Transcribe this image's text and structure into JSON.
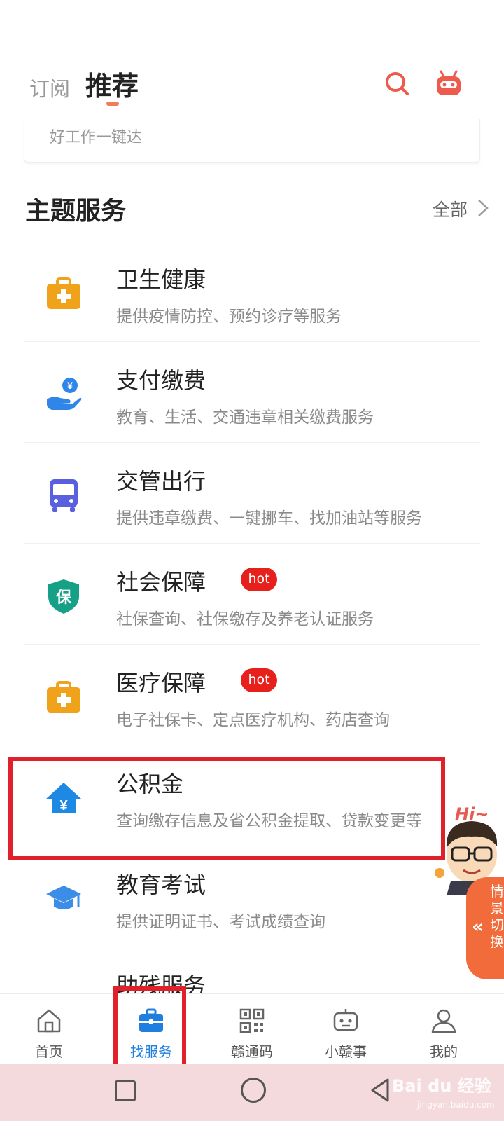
{
  "header": {
    "tab_subscribe": "订阅",
    "tab_recommend": "推荐",
    "search_icon": "search-icon",
    "robot_icon": "robot-icon"
  },
  "search": {
    "placeholder": "好工作一键达"
  },
  "section": {
    "title": "主题服务",
    "all_label": "全部"
  },
  "services": [
    {
      "title": "卫生健康",
      "desc": "提供疫情防控、预约诊疗等服务",
      "icon": "medical-kit-icon",
      "hot": ""
    },
    {
      "title": "支付缴费",
      "desc": "教育、生活、交通违章相关缴费服务",
      "icon": "payment-hand-icon",
      "hot": ""
    },
    {
      "title": "交管出行",
      "desc": "提供违章缴费、一键挪车、找加油站等服务",
      "icon": "bus-icon",
      "hot": ""
    },
    {
      "title": "社会保障",
      "desc": "社保查询、社保缴存及养老认证服务",
      "icon": "shield-bao-icon",
      "hot": "hot"
    },
    {
      "title": "医疗保障",
      "desc": "电子社保卡、定点医疗机构、药店查询",
      "icon": "medical-kit-icon",
      "hot": "hot"
    },
    {
      "title": "公积金",
      "desc": "查询缴存信息及省公积金提取、贷款变更等",
      "icon": "house-yuan-icon",
      "hot": ""
    },
    {
      "title": "教育考试",
      "desc": "提供证明证书、考试成绩查询",
      "icon": "graduation-cap-icon",
      "hot": ""
    },
    {
      "title": "助残服务",
      "desc": "",
      "icon": "",
      "hot": ""
    }
  ],
  "floating": {
    "hi": "Hi~",
    "scene_switch": "情景切换"
  },
  "tabbar": [
    {
      "label": "首页",
      "icon": "home-icon",
      "active": false
    },
    {
      "label": "找服务",
      "icon": "briefcase-icon",
      "active": true
    },
    {
      "label": "赣通码",
      "icon": "qr-code-icon",
      "active": false
    },
    {
      "label": "小赣事",
      "icon": "robot-icon",
      "active": false
    },
    {
      "label": "我的",
      "icon": "user-icon",
      "active": false
    }
  ],
  "watermark": {
    "brand": "Bai du 经验",
    "url": "jingyan.baidu.com"
  },
  "colors": {
    "accent_orange": "#ef7d5a",
    "highlight_red": "#e0202a",
    "hot_badge": "#e8201c",
    "tab_active": "#1e7fe0"
  }
}
